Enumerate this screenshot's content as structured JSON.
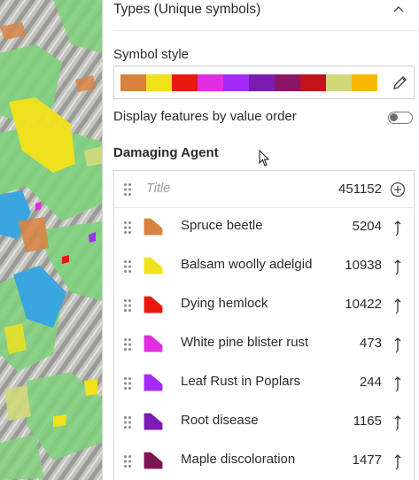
{
  "section": {
    "title": "Types (Unique symbols)",
    "chevron_icon": "chevron-up-icon"
  },
  "symbol_style": {
    "label": "Symbol style",
    "colors": [
      "#d9823f",
      "#f2e21a",
      "#e8180f",
      "#e12ee0",
      "#a42bf5",
      "#7b1bb1",
      "#8a1766",
      "#c2121b",
      "#d0d97a",
      "#f8b800"
    ],
    "edit_icon": "pencil-icon"
  },
  "order": {
    "label": "Display features by value order",
    "enabled": false
  },
  "field": {
    "label": "Damaging Agent"
  },
  "list": {
    "title_placeholder": "Title",
    "total": "451152",
    "add_icon": "plus-circle-icon",
    "items": [
      {
        "label": "Spruce beetle",
        "count": "5204",
        "color": "#d9823f"
      },
      {
        "label": "Balsam woolly adelgid",
        "count": "10938",
        "color": "#f2e21a"
      },
      {
        "label": "Dying hemlock",
        "count": "10422",
        "color": "#e8180f"
      },
      {
        "label": "White pine blister rust",
        "count": "473",
        "color": "#e12ee0"
      },
      {
        "label": "Leaf Rust in Poplars",
        "count": "244",
        "color": "#a42bf5"
      },
      {
        "label": "Root disease",
        "count": "1165",
        "color": "#7b1bb1"
      },
      {
        "label": "Maple discoloration",
        "count": "1477",
        "color": "#7d1452"
      }
    ]
  }
}
